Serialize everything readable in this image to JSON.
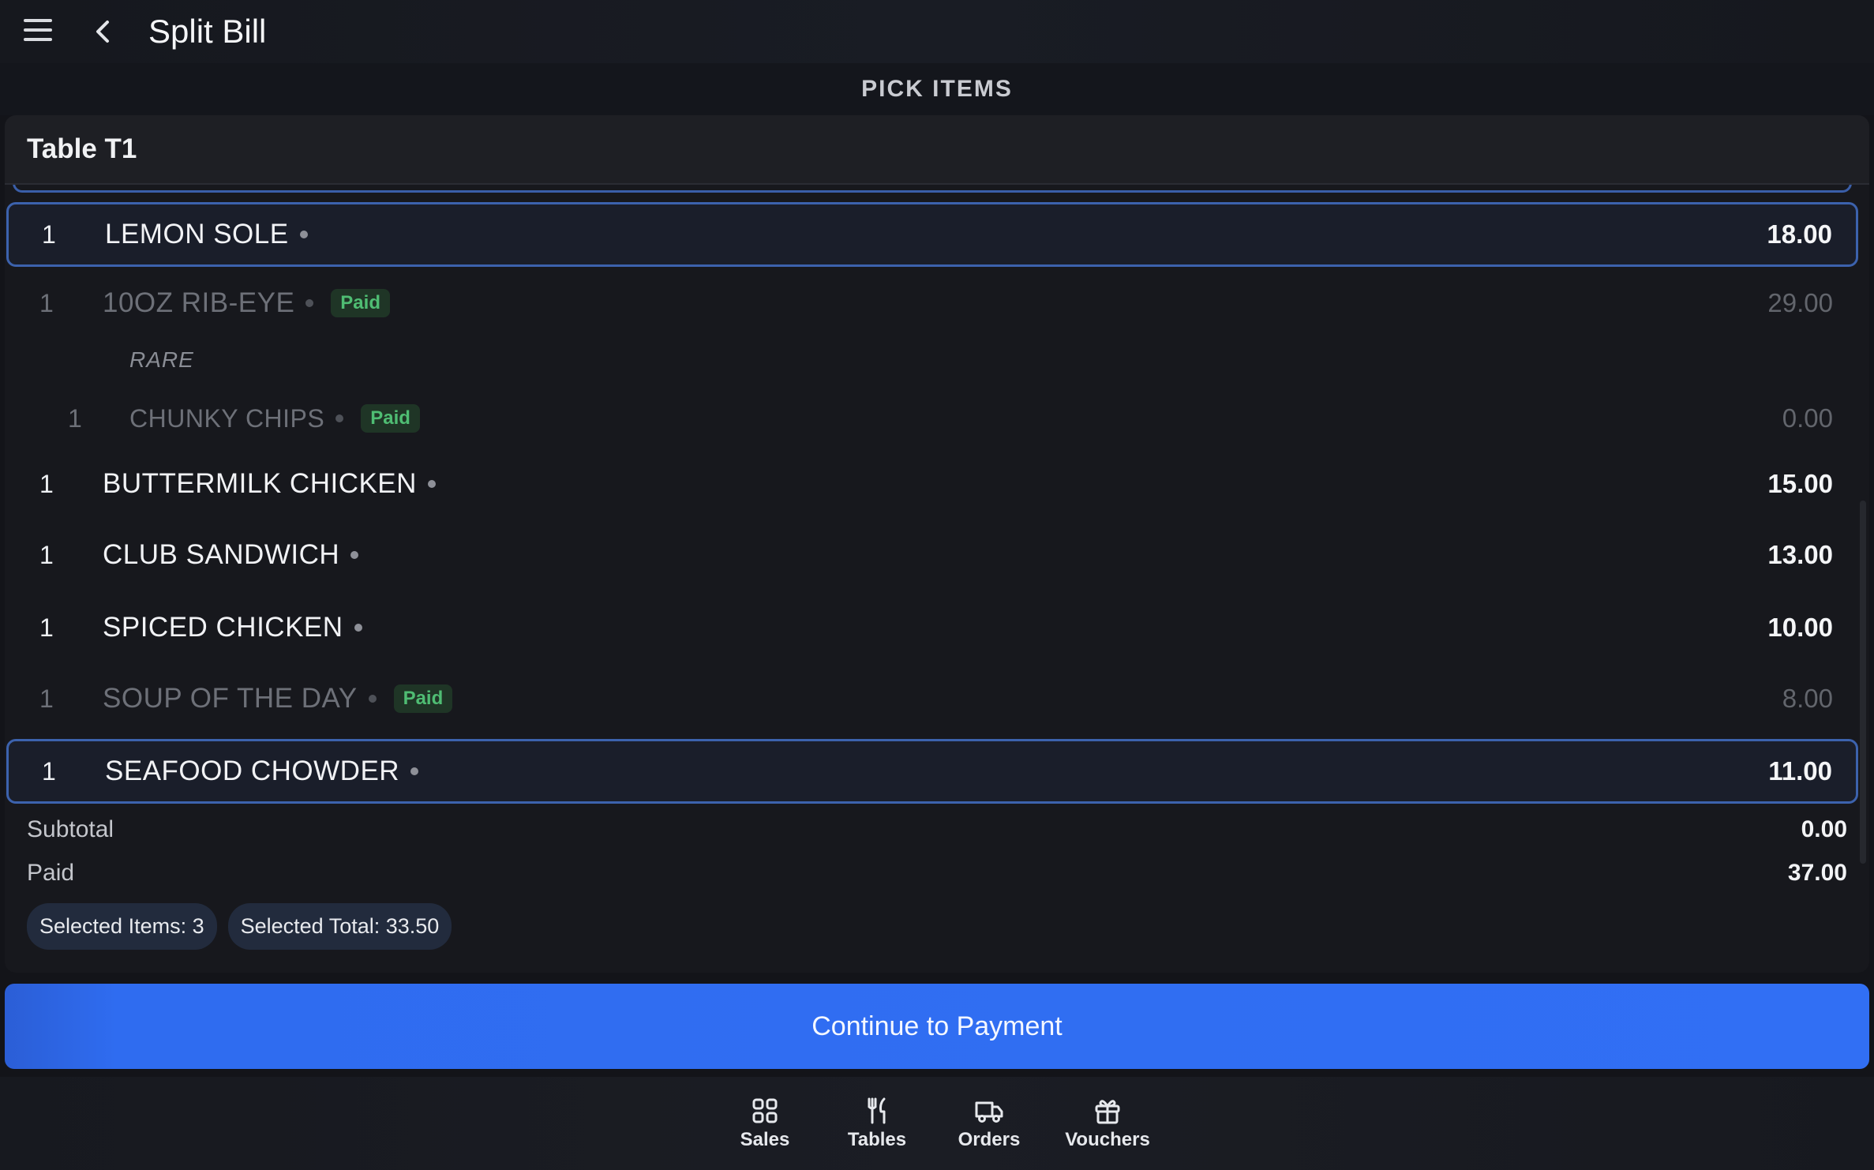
{
  "header": {
    "title": "Split Bill",
    "menu_icon": "hamburger-menu-icon",
    "back_icon": "chevron-left-icon"
  },
  "section_title": "PICK ITEMS",
  "table": {
    "name": "Table T1"
  },
  "paid_label": "Paid",
  "items": [
    {
      "qty": "1",
      "name": "LEMON SOLE",
      "price": "18.00",
      "state": "selected"
    },
    {
      "qty": "1",
      "name": "10OZ RIB-EYE",
      "price": "29.00",
      "state": "paid",
      "modifier": "RARE"
    },
    {
      "qty": "1",
      "name": "CHUNKY CHIPS",
      "price": "0.00",
      "state": "paid",
      "sub": true
    },
    {
      "qty": "1",
      "name": "BUTTERMILK CHICKEN",
      "price": "15.00",
      "state": "normal"
    },
    {
      "qty": "1",
      "name": "CLUB SANDWICH",
      "price": "13.00",
      "state": "normal"
    },
    {
      "qty": "1",
      "name": "SPICED CHICKEN",
      "price": "10.00",
      "state": "normal"
    },
    {
      "qty": "1",
      "name": "SOUP OF THE DAY",
      "price": "8.00",
      "state": "paid"
    },
    {
      "qty": "1",
      "name": "SEAFOOD CHOWDER",
      "price": "11.00",
      "state": "selected"
    }
  ],
  "totals": {
    "subtotal_label": "Subtotal",
    "subtotal_value": "0.00",
    "paid_label": "Paid",
    "paid_value": "37.00"
  },
  "chips": {
    "selected_items": "Selected Items: 3",
    "selected_total": "Selected Total: 33.50"
  },
  "continue_label": "Continue to Payment",
  "nav": [
    {
      "label": "Sales",
      "icon": "grid-icon"
    },
    {
      "label": "Tables",
      "icon": "fork-knife-icon"
    },
    {
      "label": "Orders",
      "icon": "delivery-truck-icon"
    },
    {
      "label": "Vouchers",
      "icon": "gift-icon"
    }
  ],
  "colors": {
    "accent": "#316ff4",
    "selected_border": "#3c62ad",
    "paid_badge_bg": "#1f3526",
    "paid_badge_text": "#4fbd73",
    "background": "#131419"
  }
}
